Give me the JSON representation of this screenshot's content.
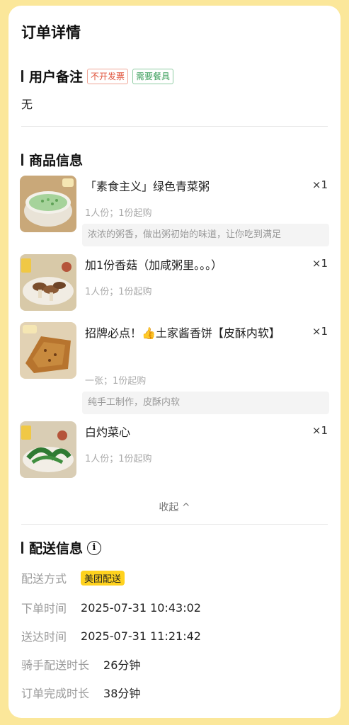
{
  "page": {
    "title": "订单详情"
  },
  "remarks": {
    "heading": "用户备注",
    "tags": [
      "不开发票",
      "需要餐具"
    ],
    "content": "无"
  },
  "products": {
    "heading": "商品信息",
    "items": [
      {
        "name": "「素食主义」绿色青菜粥",
        "qty": "×1",
        "spec": "1人份；1份起购",
        "desc": "浓浓的粥香，做出粥初始的味道，让你吃到满足"
      },
      {
        "name": "加1份香菇（加咸粥里。。。）",
        "qty": "×1",
        "spec": "1人份；1份起购",
        "desc": ""
      },
      {
        "name": "招牌必点！👍土家酱香饼【皮酥内软】",
        "qty": "×1",
        "spec": "一张；1份起购",
        "desc": "纯手工制作，皮酥内软"
      },
      {
        "name": "白灼菜心",
        "qty": "×1",
        "spec": "1人份；1份起购",
        "desc": ""
      }
    ],
    "collapse_label": "收起 ^"
  },
  "delivery": {
    "heading": "配送信息",
    "info_icon": "i",
    "method_label": "配送方式",
    "method_value": "美团配送",
    "order_time_label": "下单时间",
    "order_time_value": "2025-07-31 10:43:02",
    "arrive_time_label": "送达时间",
    "arrive_time_value": "2025-07-31 11:21:42",
    "rider_duration_label": "骑手配送时长",
    "rider_duration_value": "26分钟",
    "complete_duration_label": "订单完成时长",
    "complete_duration_value": "38分钟"
  },
  "colors": {
    "background": "#fbe79a",
    "badge": "#ffd21e",
    "tag_red": "#e0533b",
    "tag_green": "#3a9d5a"
  }
}
